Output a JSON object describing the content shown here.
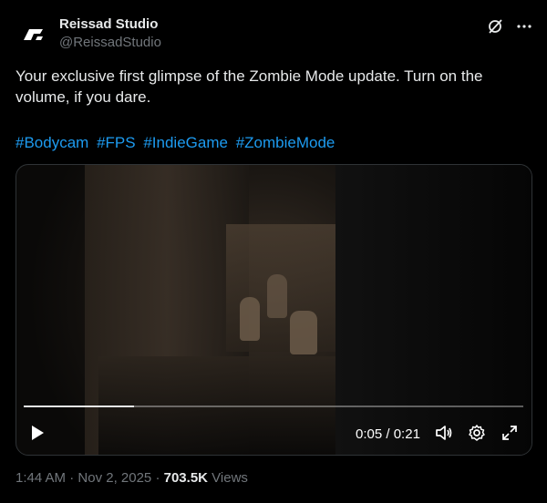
{
  "author": {
    "name": "Reissad Studio",
    "handle": "@ReissadStudio"
  },
  "icons": {
    "avatar": "logo-icon",
    "grok": "grok-icon",
    "more": "more-icon",
    "play": "play-icon",
    "volume": "volume-icon",
    "settings": "gear-icon",
    "fullscreen": "expand-icon"
  },
  "tweet": {
    "text": "Your exclusive first glimpse of the Zombie Mode update. Turn on the volume, if you dare.",
    "hashtags": [
      "#Bodycam",
      "#FPS",
      "#IndieGame",
      "#ZombieMode"
    ]
  },
  "video": {
    "current_time": "0:05",
    "time_separator": "/",
    "duration": "0:21",
    "progress_fraction": 0.22
  },
  "meta": {
    "time": "1:44 AM",
    "separator": "·",
    "date": "Nov 2, 2025",
    "views_count": "703.5K",
    "views_label": "Views"
  },
  "colors": {
    "accent": "#1d9bf0",
    "text": "#e7e9ea",
    "muted": "#71767b",
    "border": "#2f3336"
  }
}
